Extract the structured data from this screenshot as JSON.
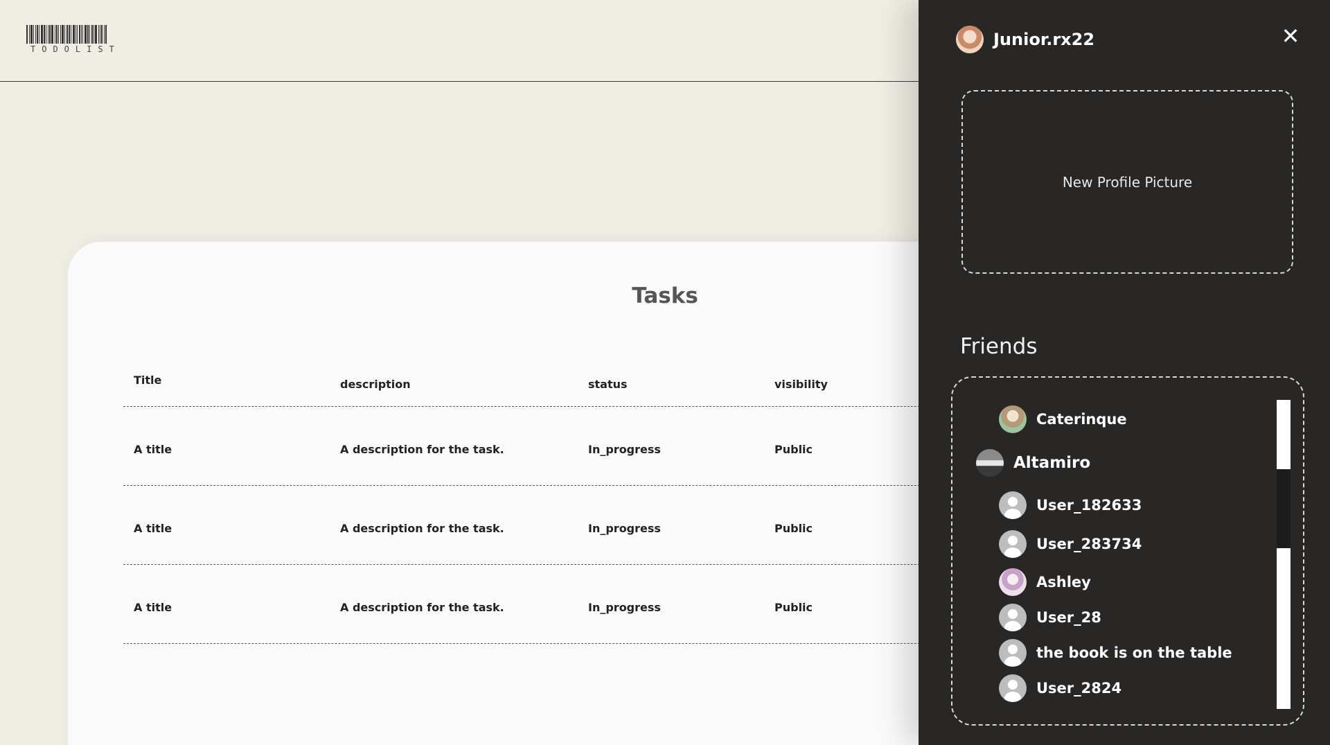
{
  "app": {
    "logo_text": "TODOLIST"
  },
  "tasks": {
    "title": "Tasks",
    "columns": [
      "Title",
      "description",
      "status",
      "visibility"
    ],
    "rows": [
      [
        "A title",
        "A description for the task.",
        "In_progress",
        "Public"
      ],
      [
        "A title",
        "A description for the task.",
        "In_progress",
        "Public"
      ],
      [
        "A title",
        "A description for the task.",
        "In_progress",
        "Public"
      ]
    ]
  },
  "drawer": {
    "username": "Junior.rx22",
    "close_icon": "close-icon",
    "upload_label": "New Profile Picture",
    "friends_title": "Friends",
    "friends": [
      {
        "name": "Caterinque",
        "avatar": "anime-avatar"
      },
      {
        "name": "Altamiro",
        "avatar": "car-avatar"
      },
      {
        "name": "User_182633",
        "avatar": "default-user-icon"
      },
      {
        "name": "User_283734",
        "avatar": "default-user-icon"
      },
      {
        "name": "Ashley",
        "avatar": "anime-avatar"
      },
      {
        "name": "User_28",
        "avatar": "default-user-icon"
      },
      {
        "name": "the book is on the table",
        "avatar": "default-user-icon"
      },
      {
        "name": "User_2824",
        "avatar": "default-user-icon"
      }
    ]
  },
  "colors": {
    "page_bg": "#f0ede4",
    "drawer_bg": "#282725",
    "card_bg": "#fafafa"
  }
}
